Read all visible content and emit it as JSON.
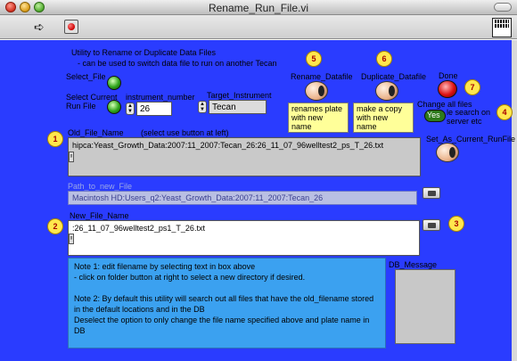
{
  "window": {
    "title": "Rename_Run_File.vi"
  },
  "toolbar": {
    "run_glyph": "➪",
    "abort_label": ""
  },
  "vi_icon": {
    "text": ""
  },
  "panel": {
    "description_line1": "Utility to Rename or Duplicate Data Files",
    "description_line2": "- can be used to switch data file to run on another Tecan",
    "select_file_label": "Select_File",
    "select_current_label": "Select Current\nRun File",
    "instrument_number_label": "instrument_number",
    "instrument_number_value": "26",
    "target_instrument_label": "Target_Instrument",
    "target_instrument_value": "Tecan",
    "rename_label": "Rename_Datafile",
    "rename_note": "renames plate\nwith new name",
    "duplicate_label": "Duplicate_Datafile",
    "duplicate_note": "make a copy\nwith new name",
    "done_label": "Done",
    "change_all_label": "Change all files",
    "change_all_sub": "le search on\nserver etc",
    "toggle_text": "Yes",
    "old_file_label": "Old_File_Name",
    "old_file_hint": "(select use button at left)",
    "old_file_value": "hipca:Yeast_Growth_Data:2007:11_2007:Tecan_26:26_11_07_96welltest2_ps_T_26.txt",
    "set_as_label": "Set_As_Current_RunFile",
    "path_label": "Path_to_new_File",
    "path_value": "Macintosh HD:Users_q2:Yeast_Growth_Data:2007:11_2007:Tecan_26",
    "new_file_label": "New_File_Name",
    "new_file_value": ":26_11_07_96welltest2_ps1_T_26.txt",
    "notes": "Note 1: edit filename by selecting text in box above\n- click on folder button at right to select a new directory if desired.\n\nNote 2:  By default this utility will search out all files that have the old_filename stored in the default locations and in the DB\nDeselect the option to only change the file name specified above and plate name in DB",
    "db_message_label": "DB_Message",
    "db_message_value": ""
  },
  "badges": [
    "1",
    "2",
    "3",
    "4",
    "5",
    "6",
    "7"
  ],
  "colors": {
    "panel": "#2a3cff",
    "notes_bg": "#3ba1f0",
    "badge": "#ffe74d"
  }
}
